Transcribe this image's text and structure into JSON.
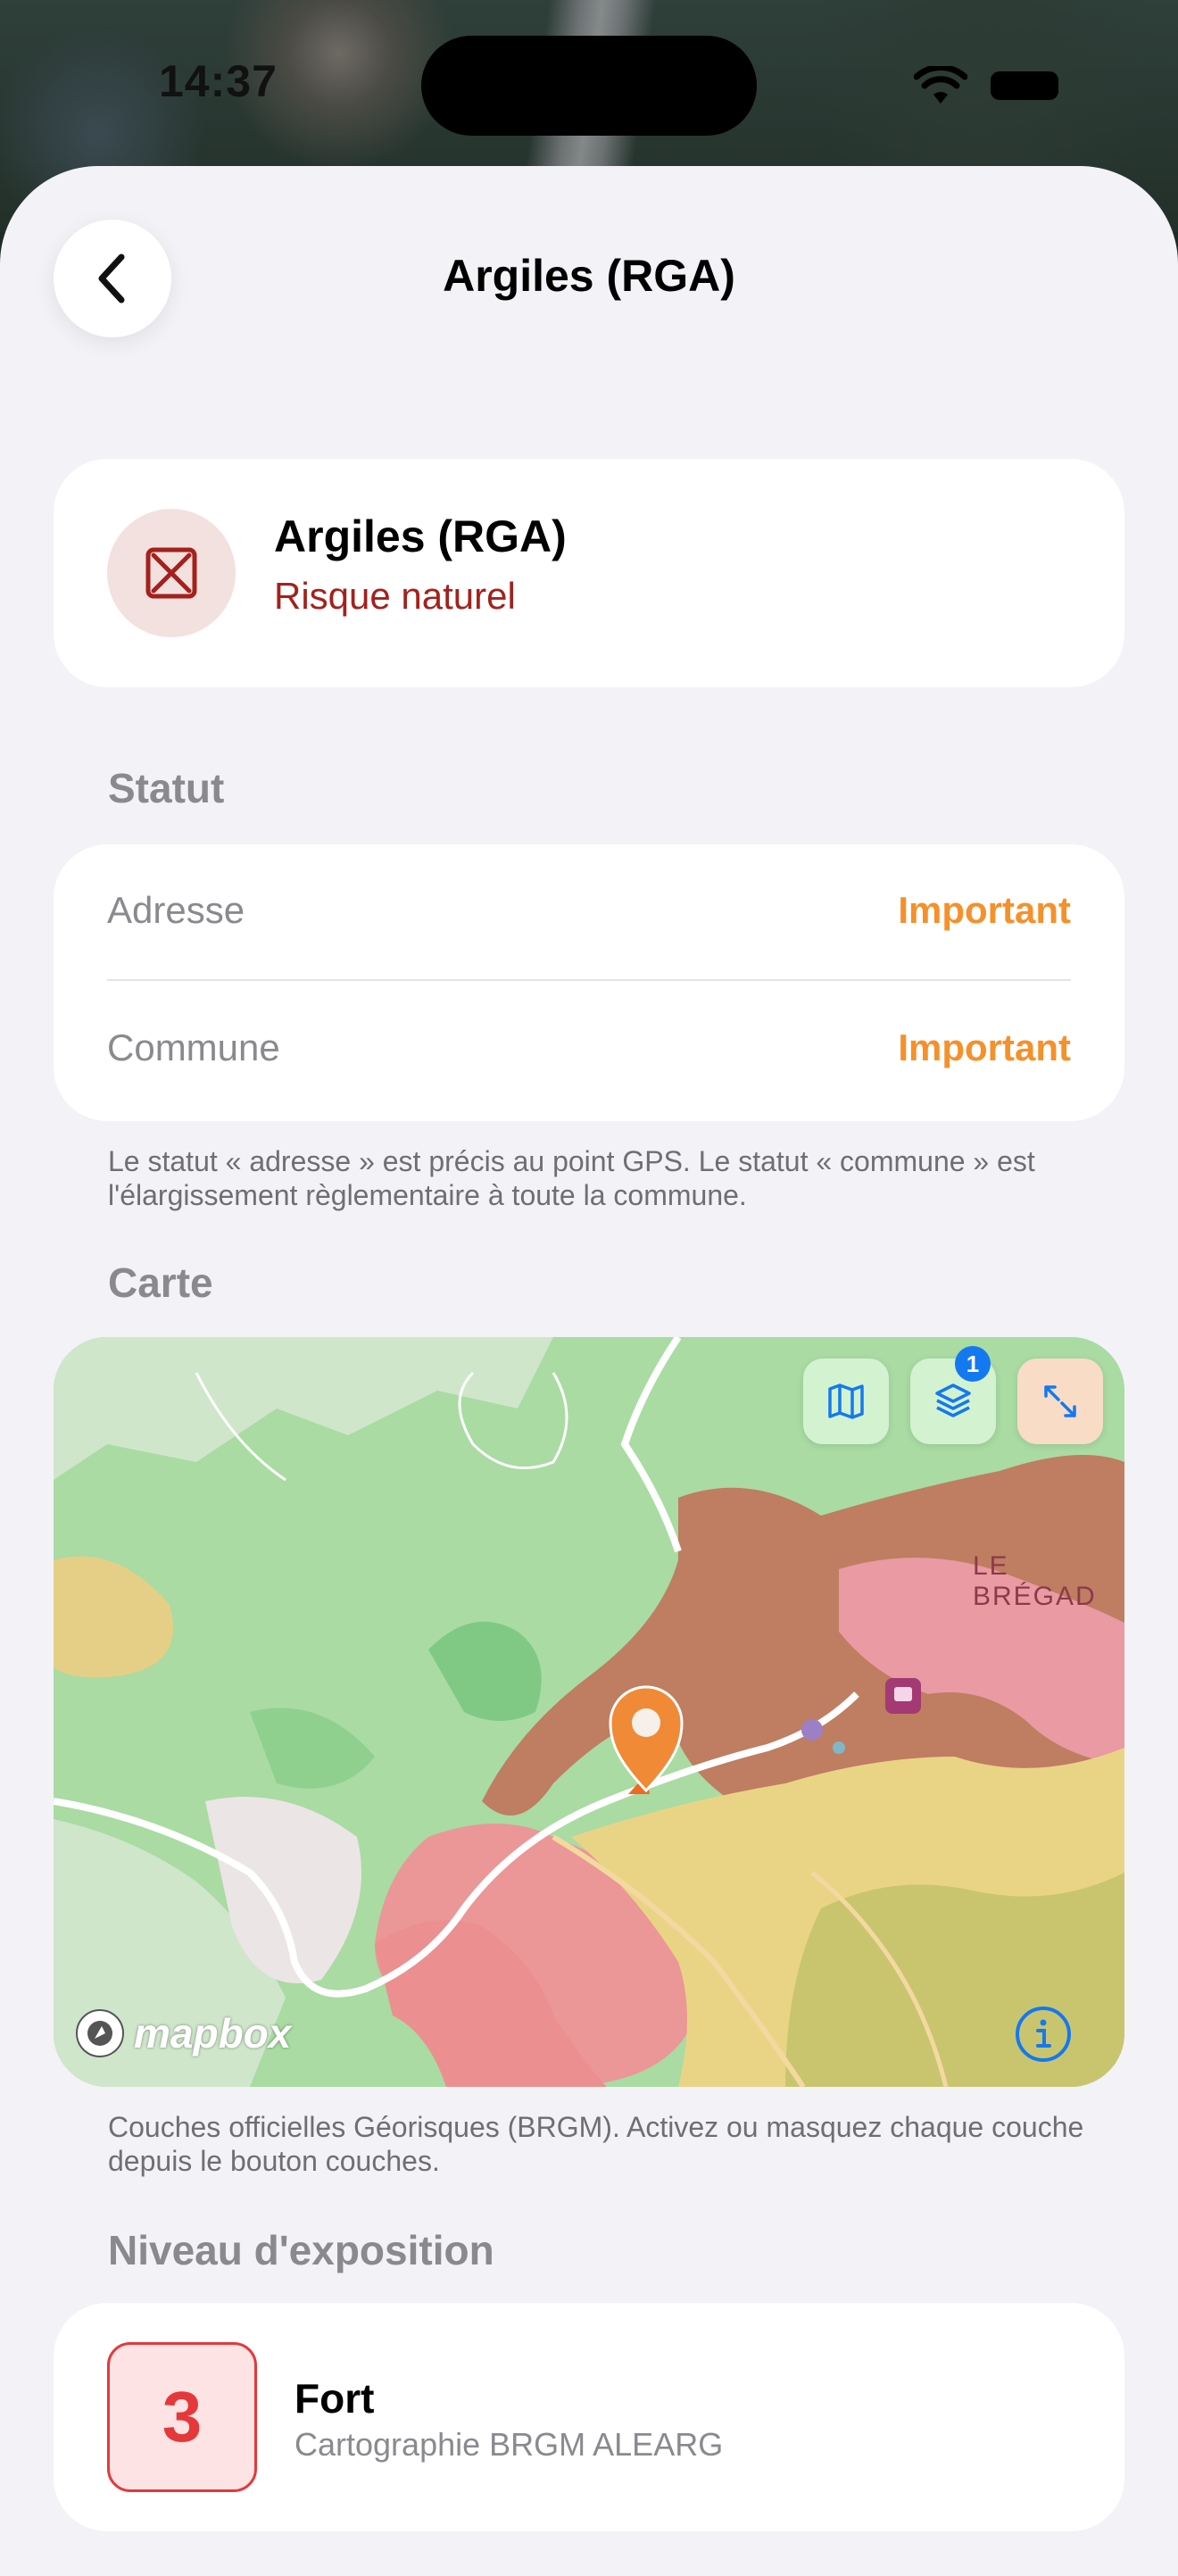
{
  "status_bar": {
    "time": "14:37"
  },
  "nav": {
    "title": "Argiles (RGA)",
    "back_icon": "chevron-left-icon"
  },
  "hazard": {
    "title": "Argiles (RGA)",
    "category": "Risque naturel",
    "icon": "clay-hazard-icon"
  },
  "statut": {
    "section_label": "Statut",
    "rows": [
      {
        "label": "Adresse",
        "value": "Important"
      },
      {
        "label": "Commune",
        "value": "Important"
      }
    ],
    "footnote": "Le statut « adresse » est précis au point GPS. Le statut « commune » est l'élargissement règlementaire à toute la commune."
  },
  "carte": {
    "section_label": "Carte",
    "layers_badge": "1",
    "place_label": "LE BRÉGAD",
    "attribution": "mapbox",
    "buttons": [
      "map-style-icon",
      "layers-icon",
      "expand-icon"
    ],
    "footnote": "Couches officielles Géorisques (BRGM). Activez ou masquez chaque couche depuis le bouton couches."
  },
  "exposition": {
    "section_label": "Niveau d'exposition",
    "level": "3",
    "title": "Fort",
    "subtitle": "Cartographie BRGM ALEARG"
  },
  "colors": {
    "accent_orange": "#f6902b",
    "risk_red": "#a3211d",
    "level_red": "#e5383b",
    "map_blue": "#1479f0"
  }
}
